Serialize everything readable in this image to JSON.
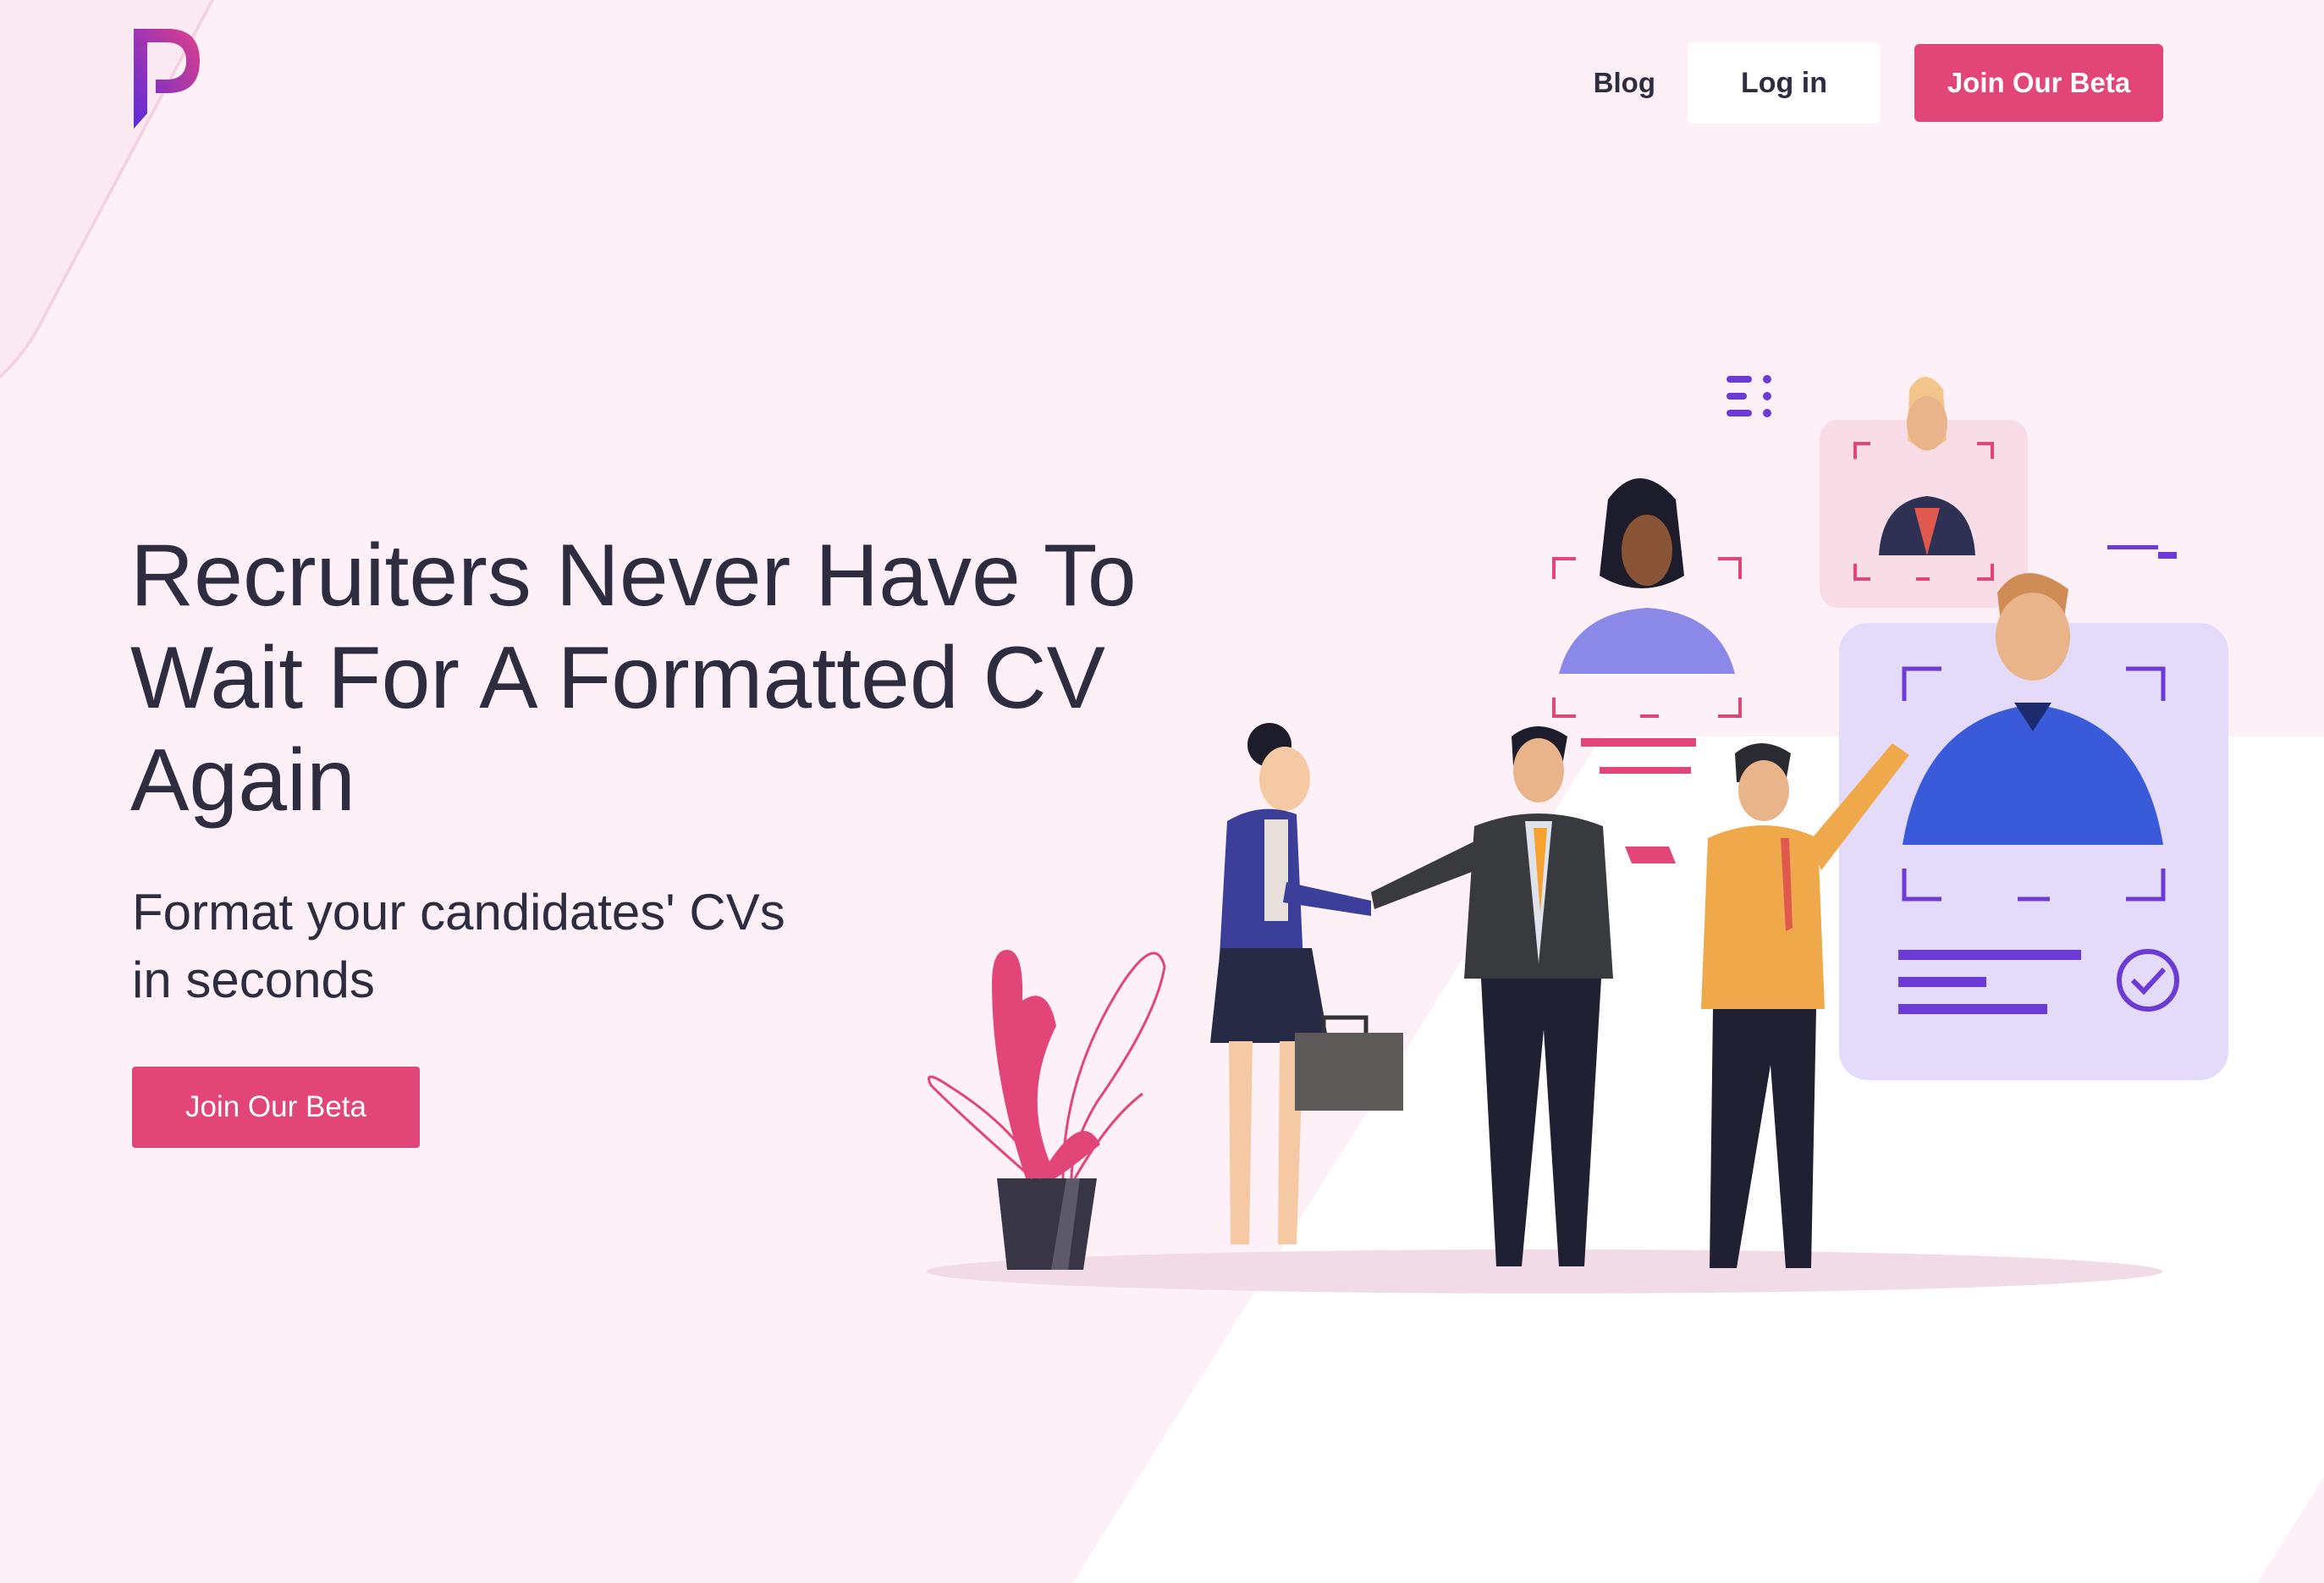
{
  "header": {
    "logo_letter": "P",
    "nav": {
      "blog": "Blog",
      "login": "Log in",
      "join_beta": "Join Our Beta"
    }
  },
  "hero": {
    "title_lines": [
      "Recruiters Never Have To",
      "Wait For A Formatted CV",
      "Again"
    ],
    "subtitle_lines": [
      "Format your candidates' CVs",
      "in seconds"
    ],
    "cta": "Join Our Beta"
  },
  "colors": {
    "brand_pink": "#e24577",
    "brand_purple": "#6c3bd6",
    "background": "#fdf1f7",
    "text": "#2e2d40"
  },
  "icons": [
    "logo-p-icon",
    "menu-dots-icon",
    "check-circle-icon",
    "briefcase-icon"
  ]
}
